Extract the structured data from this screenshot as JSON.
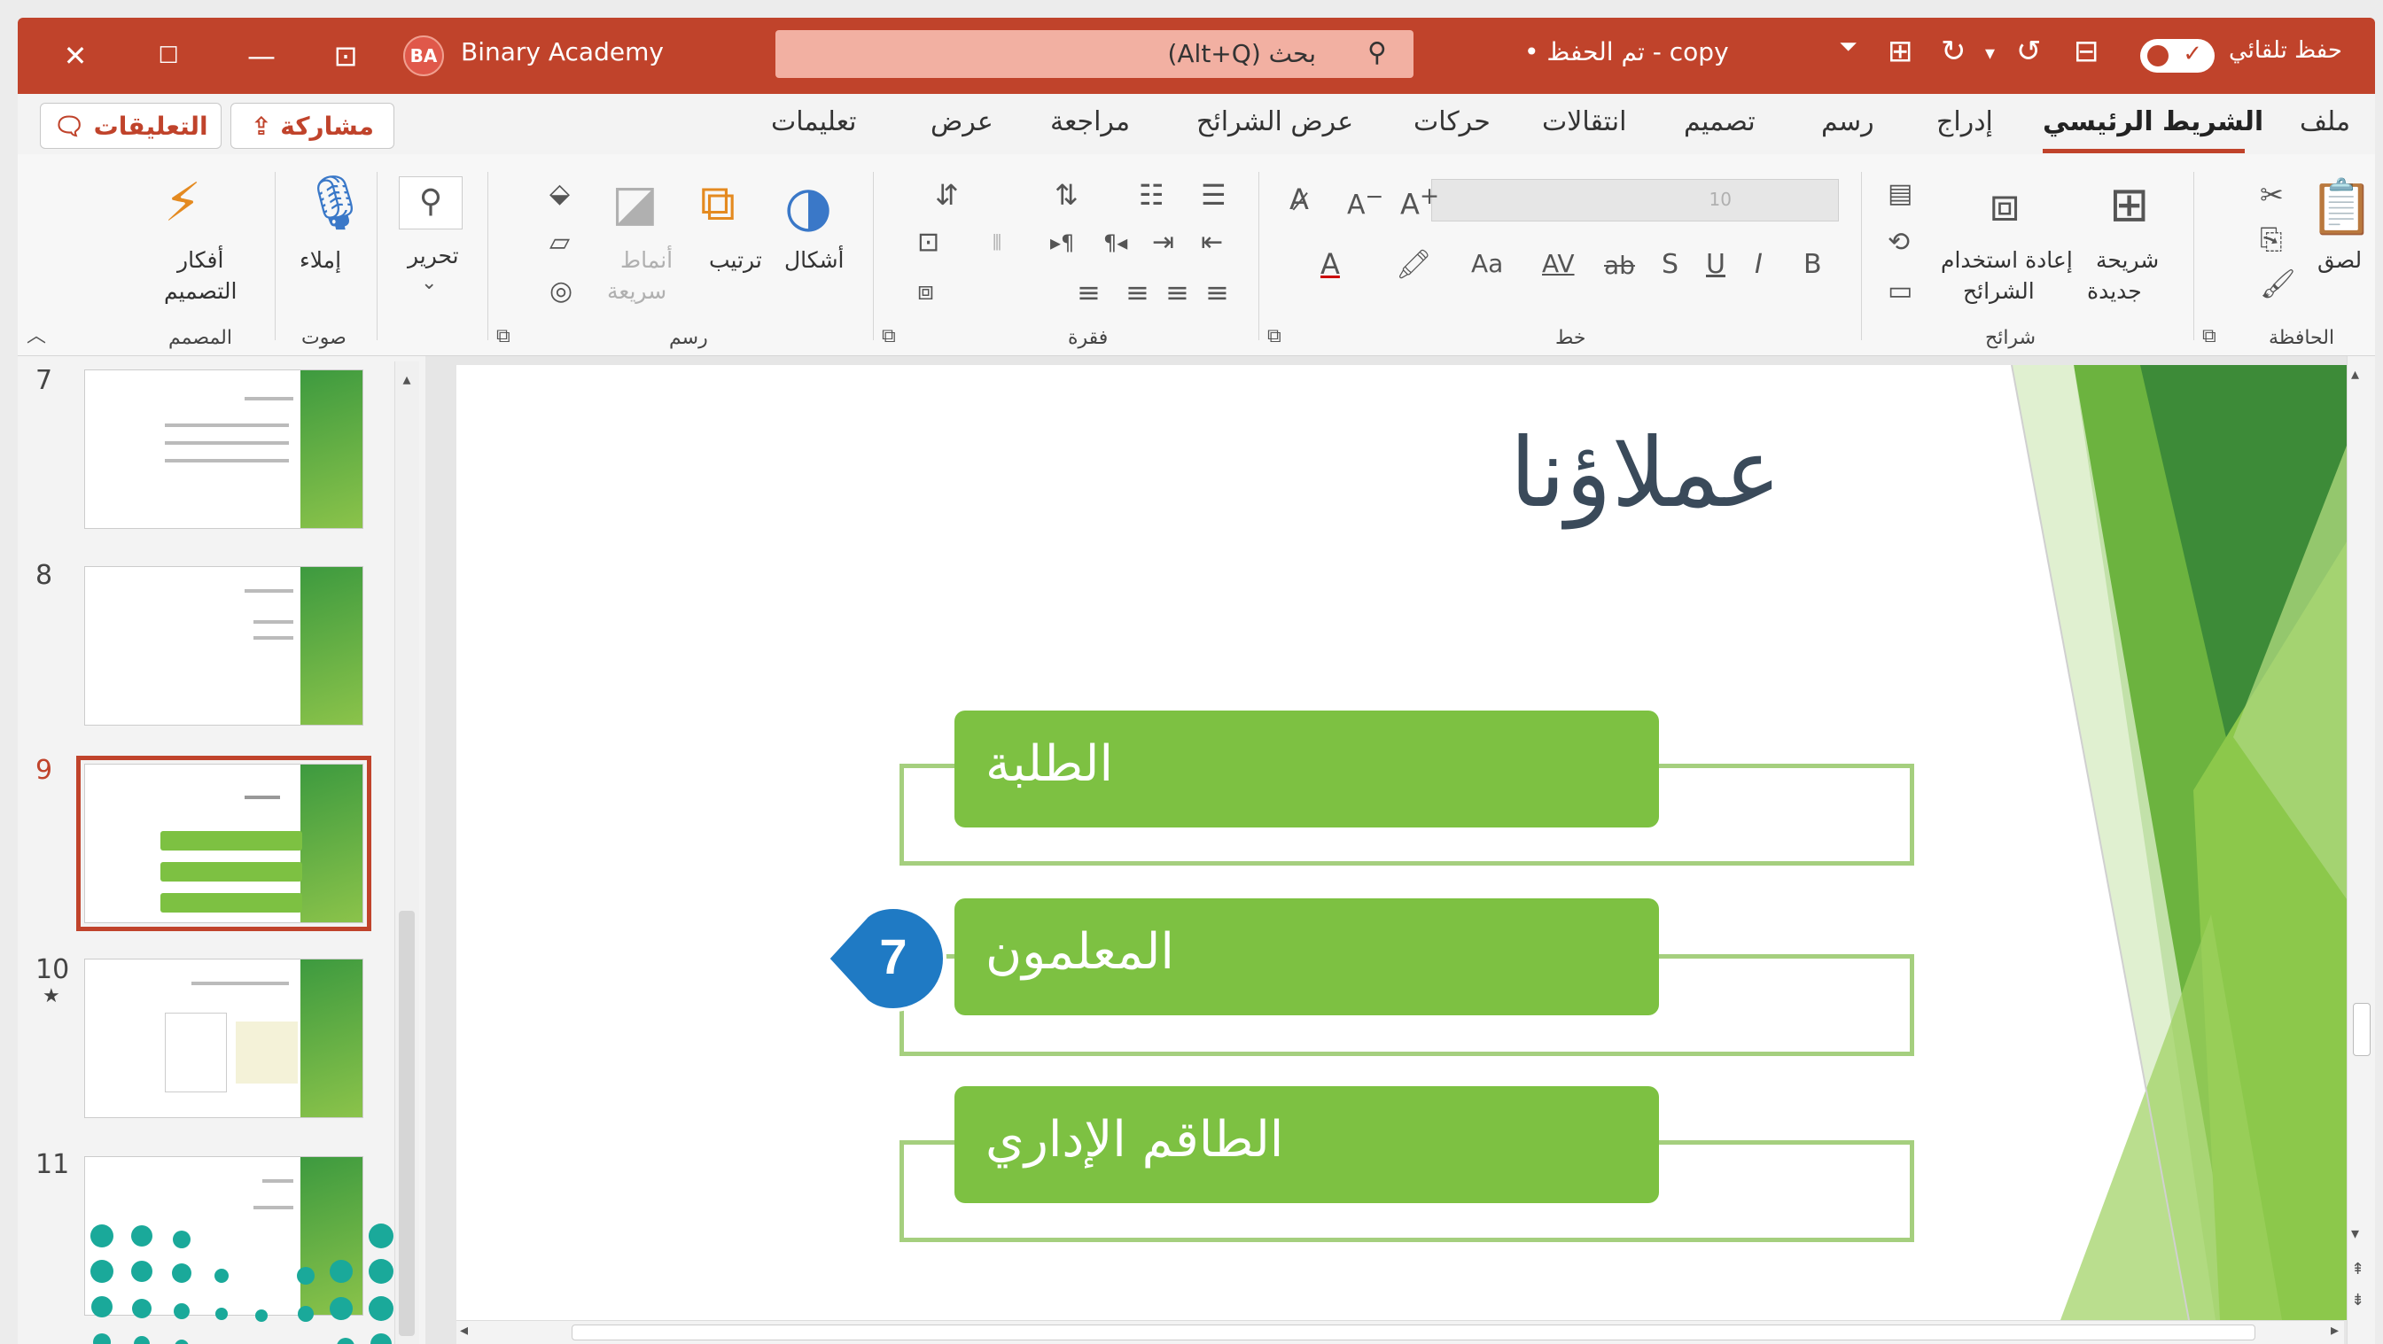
{
  "titlebar": {
    "close": "✕",
    "restore": "☐",
    "minimize": "—",
    "ribbon_display": "⊡",
    "avatar_initials": "BA",
    "user_name": "Binary Academy",
    "search_placeholder": "بحث (Alt+Q)",
    "doc_name": "copy - تم الحفظ •",
    "autosave_label": "حفظ تلقائي",
    "accent_color": "#c0432b"
  },
  "tabs": {
    "comments_button": "التعليقات",
    "share_button": "مشاركة",
    "items": [
      "ملف",
      "الشريط الرئيسي",
      "إدراج",
      "رسم",
      "تصميم",
      "انتقالات",
      "حركات",
      "عرض الشرائح",
      "مراجعة",
      "عرض",
      "تعليمات"
    ],
    "active": "الشريط الرئيسي"
  },
  "ribbon": {
    "clipboard": {
      "paste": "لصق",
      "group": "الحافظة"
    },
    "slides": {
      "new_slide_1": "شريحة",
      "new_slide_2": "جديدة",
      "reuse_1": "إعادة استخدام",
      "reuse_2": "الشرائح",
      "group": "شرائح"
    },
    "font": {
      "size": "10",
      "group": "خط",
      "bold": "B",
      "italic": "I",
      "underline": "U",
      "shadow": "S",
      "strike": "ab",
      "spacing": "AV",
      "case": "Aa",
      "grow": "A",
      "shrink": "A"
    },
    "paragraph": {
      "group": "فقرة"
    },
    "drawing": {
      "shapes": "أشكال",
      "arrange": "ترتيب",
      "quick_styles_1": "أنماط",
      "quick_styles_2": "سريعة",
      "group": "رسم"
    },
    "editing": {
      "label": "تحرير"
    },
    "voice": {
      "dictate": "إملاء",
      "group": "صوت"
    },
    "designer": {
      "ideas_1": "أفكار",
      "ideas_2": "التصميم",
      "group": "المصمم"
    }
  },
  "thumbnails": [
    {
      "num": "7",
      "star": ""
    },
    {
      "num": "8",
      "star": ""
    },
    {
      "num": "9",
      "star": "",
      "selected": true
    },
    {
      "num": "10",
      "star": "★"
    },
    {
      "num": "11",
      "star": ""
    }
  ],
  "slide": {
    "title": "عملاؤنا",
    "boxes": [
      "الطلبة",
      "المعلمون",
      "الطاقم الإداري"
    ],
    "callout_number": "7",
    "green": "#7dc142",
    "outline_green": "#a5cf7e"
  }
}
